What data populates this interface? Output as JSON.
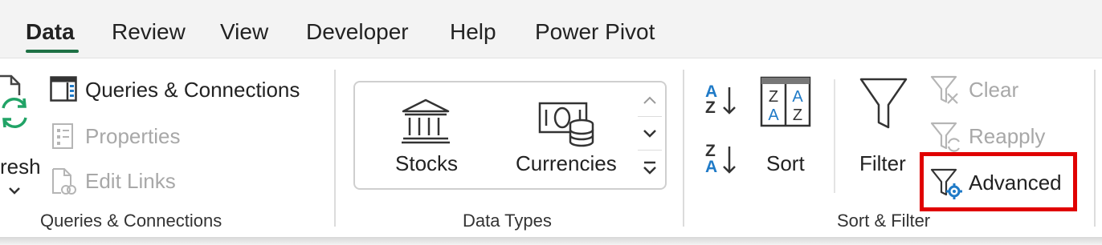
{
  "tabs": [
    {
      "label": "Data",
      "active": true
    },
    {
      "label": "Review"
    },
    {
      "label": "View"
    },
    {
      "label": "Developer"
    },
    {
      "label": "Help"
    },
    {
      "label": "Power Pivot"
    }
  ],
  "queries_group": {
    "refresh_label_partial": "resh",
    "queries_connections": "Queries & Connections",
    "properties": "Properties",
    "edit_links": "Edit Links",
    "group_label": "Queries & Connections"
  },
  "data_types_group": {
    "stocks": "Stocks",
    "currencies": "Currencies",
    "group_label": "Data Types"
  },
  "sort_filter_group": {
    "sort_az_top": "A",
    "sort_az_bottom": "Z",
    "sort_za_top": "Z",
    "sort_za_bottom": "A",
    "sort": "Sort",
    "filter": "Filter",
    "clear": "Clear",
    "reapply": "Reapply",
    "advanced": "Advanced",
    "group_label": "Sort & Filter"
  },
  "colors": {
    "accent_green": "#1e7145",
    "highlight_red": "#e00000",
    "sort_blue": "#1f7ac7",
    "refresh_green": "#21a366"
  }
}
